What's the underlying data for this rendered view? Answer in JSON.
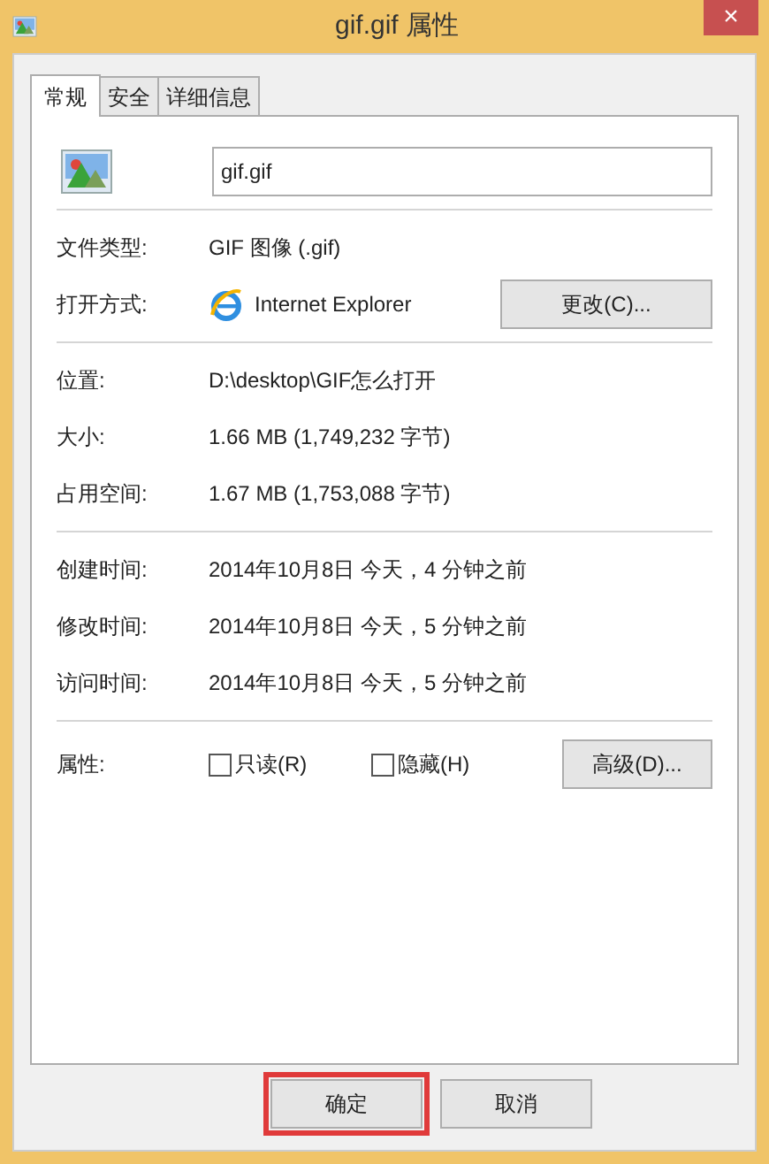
{
  "window": {
    "title": "gif.gif 属性",
    "close": "×"
  },
  "tabs": [
    {
      "label": "常规",
      "selected": true
    },
    {
      "label": "安全",
      "selected": false
    },
    {
      "label": "详细信息",
      "selected": false
    }
  ],
  "file_name": {
    "value": "gif.gif"
  },
  "sections": [
    [
      {
        "kind": "text",
        "label": "文件类型:",
        "value": "GIF 图像 (.gif)"
      },
      {
        "kind": "app",
        "label": "打开方式:",
        "value": "Internet Explorer",
        "button": "更改(C)..."
      }
    ],
    [
      {
        "kind": "text",
        "label": "位置:",
        "value": "D:\\desktop\\GIF怎么打开"
      },
      {
        "kind": "text",
        "label": "大小:",
        "value": "1.66 MB (1,749,232 字节)"
      },
      {
        "kind": "text",
        "label": "占用空间:",
        "value": "1.67 MB (1,753,088 字节)"
      }
    ],
    [
      {
        "kind": "text",
        "label": "创建时间:",
        "value": "2014年10月8日 今天，4 分钟之前"
      },
      {
        "kind": "text",
        "label": "修改时间:",
        "value": "2014年10月8日 今天，5 分钟之前"
      },
      {
        "kind": "text",
        "label": "访问时间:",
        "value": "2014年10月8日 今天，5 分钟之前"
      }
    ]
  ],
  "attributes": {
    "label": "属性:",
    "checkboxes": [
      {
        "label": "只读(R)",
        "checked": false
      },
      {
        "label": "隐藏(H)",
        "checked": false
      }
    ],
    "button": "高级(D)..."
  },
  "buttons": [
    {
      "label": "确定",
      "highlighted": true
    },
    {
      "label": "取消",
      "highlighted": false
    }
  ]
}
